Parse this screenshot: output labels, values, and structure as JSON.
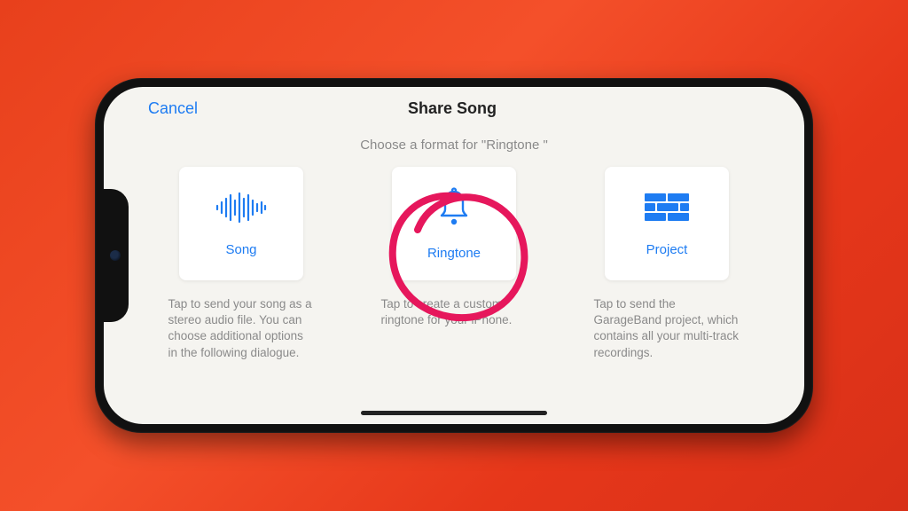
{
  "header": {
    "cancel": "Cancel",
    "title": "Share Song"
  },
  "subtitle": "Choose a format for \"Ringtone \"",
  "cards": [
    {
      "label": "Song",
      "desc": "Tap to send your song as a stereo audio file. You can choose additional options in the following dialogue."
    },
    {
      "label": "Ringtone",
      "desc": "Tap to create a custom ringtone for your iPhone."
    },
    {
      "label": "Project",
      "desc": "Tap to send the GarageBand project, which contains all your multi-track recordings."
    }
  ],
  "colors": {
    "accent": "#1e7cf2",
    "annotation": "#e6175c"
  }
}
